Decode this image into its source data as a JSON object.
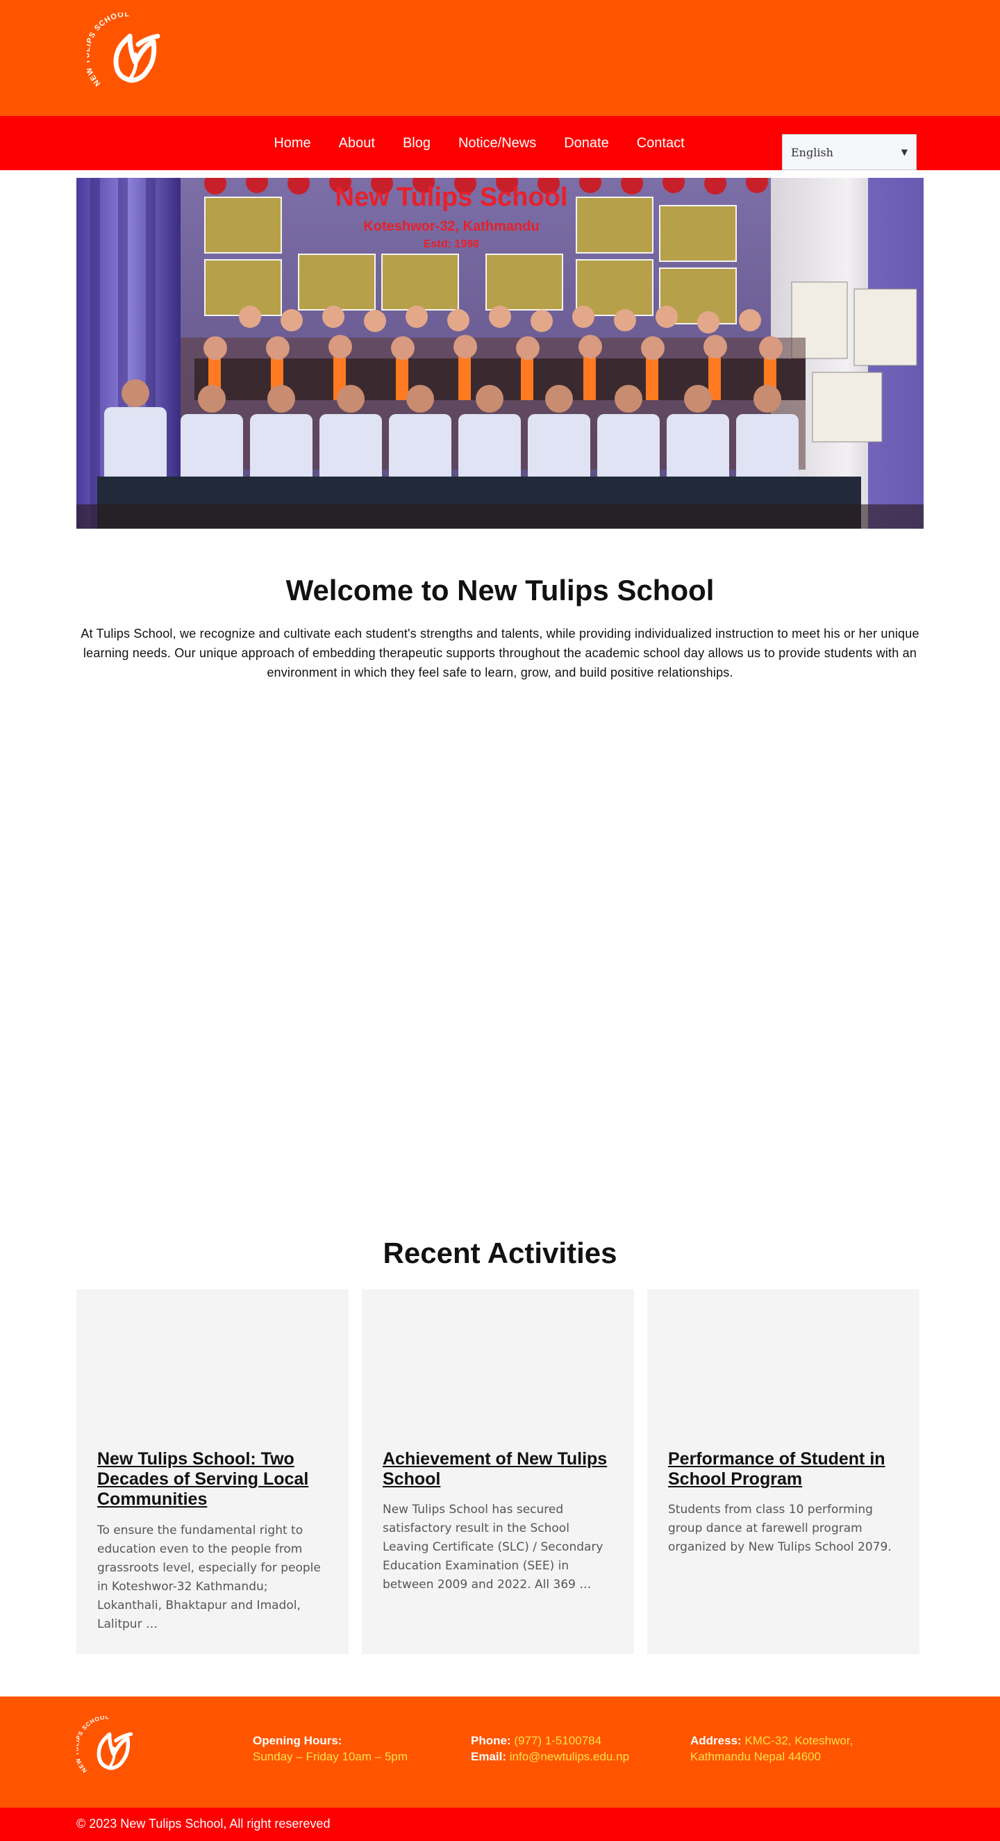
{
  "brand": {
    "logo_text": "NEW TULIPS SCHOOL",
    "primary_color": "#ff5500",
    "nav_color": "#ff0000",
    "accent_text_color": "#ffe14a"
  },
  "nav": {
    "items": [
      {
        "label": "Home"
      },
      {
        "label": "About"
      },
      {
        "label": "Blog"
      },
      {
        "label": "Notice/News"
      },
      {
        "label": "Donate"
      },
      {
        "label": "Contact"
      }
    ],
    "language": "English"
  },
  "hero": {
    "banner_title": "New Tulips School",
    "banner_subtitle": "Koteshwor-32, Kathmandu",
    "banner_estd": "Estd: 1998"
  },
  "welcome": {
    "title": "Welcome to New Tulips School",
    "text": "At Tulips School, we recognize and cultivate each student's strengths and talents, while providing individualized instruction to meet his or her unique learning needs. Our unique approach of embedding therapeutic supports throughout the academic school day allows us to provide students with an environment in which they feel safe to learn, grow, and build positive relationships."
  },
  "recent": {
    "title": "Recent Activities",
    "cards": [
      {
        "title": "New Tulips School: Two Decades of Serving Local Communities",
        "text": "To ensure the fundamental right to education even to the people from grassroots level, especially for people in Koteshwor-32 Kathmandu; Lokanthali, Bhaktapur and Imadol, Lalitpur …"
      },
      {
        "title": "Achievement of New Tulips School",
        "text": "New Tulips School has secured satisfactory result in the School Leaving Certificate (SLC) / Secondary Education Examination (SEE) in between 2009 and 2022. All 369 …"
      },
      {
        "title": "Performance of Student in School Program",
        "text": "Students from class 10 performing group dance at farewell program organized by New Tulips School 2079."
      }
    ]
  },
  "footer": {
    "hours_label": "Opening Hours:",
    "hours_value": "Sunday – Friday 10am – 5pm",
    "phone_label": "Phone:",
    "phone_value": "(977) 1-5100784",
    "email_label": "Email:",
    "email_value": "info@newtulips.edu.np",
    "address_label": "Address:",
    "address_value_1": "KMC-32, Koteshwor,",
    "address_value_2": "Kathmandu Nepal 44600",
    "copyright": "© 2023 New Tulips School, All right resereved"
  }
}
